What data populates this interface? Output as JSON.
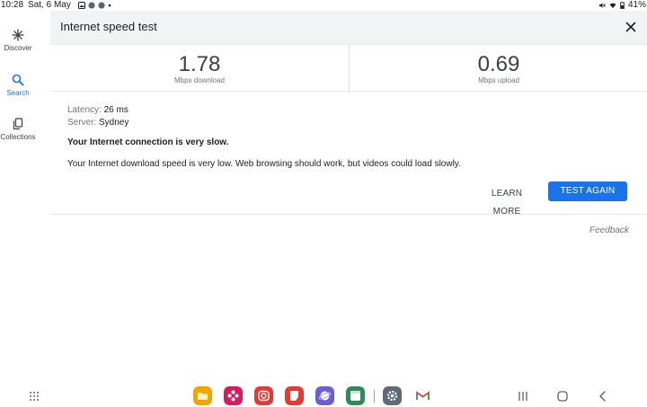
{
  "status_bar": {
    "time": "10:28",
    "date": "Sat, 6 May",
    "battery": "41%"
  },
  "nav": {
    "items": [
      {
        "label": "Discover",
        "icon": "asterisk-icon",
        "active": false
      },
      {
        "label": "Search",
        "icon": "search-icon",
        "active": true
      },
      {
        "label": "Collections",
        "icon": "collections-icon",
        "active": false
      }
    ]
  },
  "card": {
    "title": "Internet speed test",
    "download": {
      "value": "1.78",
      "unit": "Mbps download"
    },
    "upload": {
      "value": "0.69",
      "unit": "Mbps upload"
    },
    "latency": {
      "label": "Latency:",
      "value": "26 ms"
    },
    "server": {
      "label": "Server:",
      "value": "Sydney"
    },
    "headline": "Your Internet connection is very slow.",
    "detail": "Your Internet download speed is very low. Web browsing should work, but videos could load slowly.",
    "learn_more": "LEARN MORE",
    "test_again": "TEST AGAIN"
  },
  "feedback": "Feedback",
  "colors": {
    "accent": "#1a73e8",
    "header_bg": "#f1f3f4"
  },
  "taskbar": {
    "apps": [
      {
        "name": "my-files-icon",
        "color": "#f4a300"
      },
      {
        "name": "blossom-app-icon",
        "color": "#d81b60"
      },
      {
        "name": "camera-app-icon",
        "color": "#e53935"
      },
      {
        "name": "notes-app-icon",
        "color": "#e53935"
      },
      {
        "name": "internet-browser-icon",
        "color": "#6b5bd6"
      },
      {
        "name": "calendar-app-icon",
        "color": "#2e8b57"
      },
      {
        "name": "settings-app-icon",
        "color": "#5f6b78"
      },
      {
        "name": "gmail-app-icon",
        "color": "#ffffff"
      }
    ]
  }
}
